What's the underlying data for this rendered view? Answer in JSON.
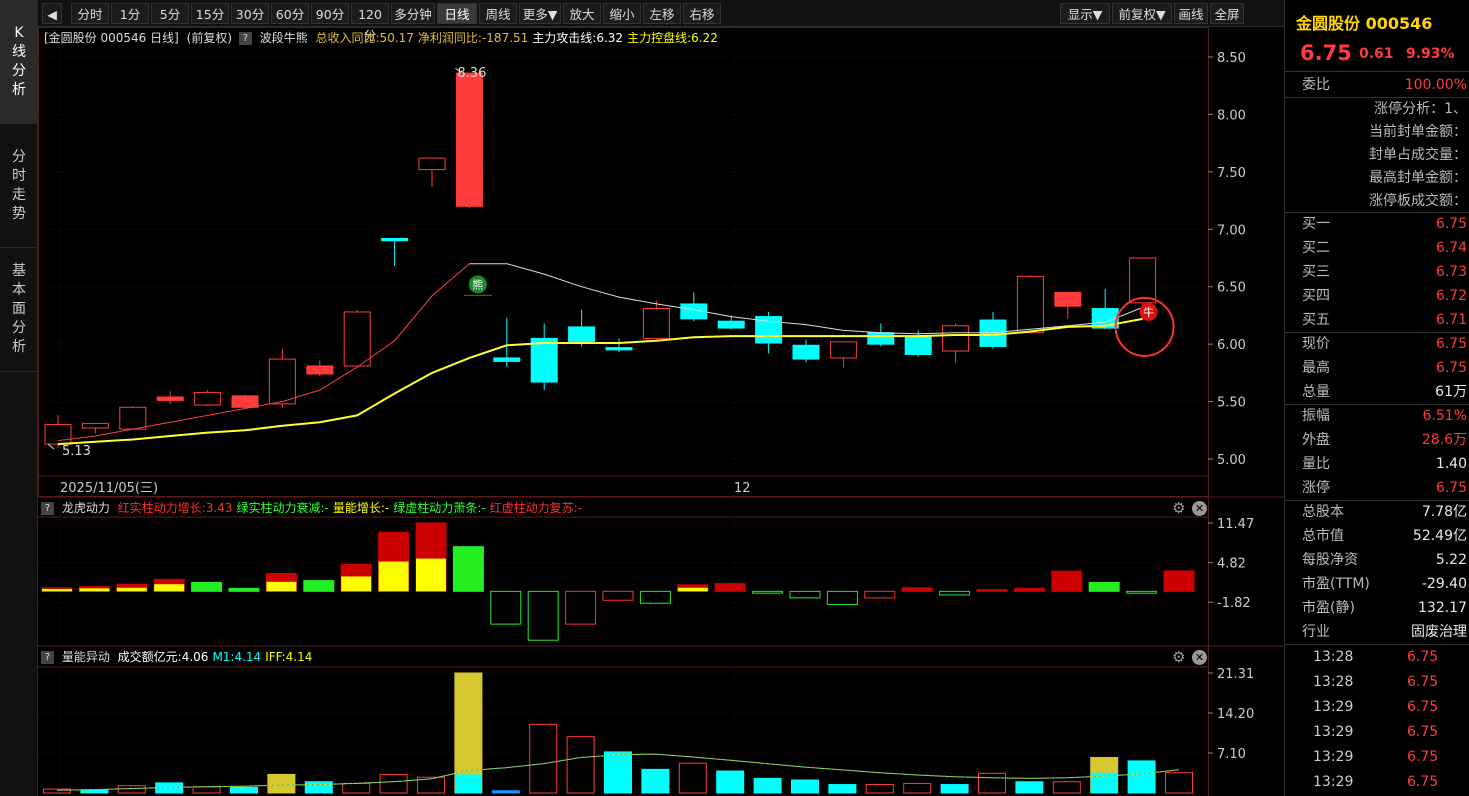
{
  "left_tabs": [
    {
      "label": "K线分析",
      "chars": [
        "K",
        "线",
        "分",
        "析"
      ]
    },
    {
      "label": "分时走势",
      "chars": [
        "分",
        "时",
        "走",
        "势"
      ]
    },
    {
      "label": "基本面分析",
      "chars": [
        "基",
        "本",
        "面",
        "分",
        "析"
      ]
    }
  ],
  "toolbar": {
    "toggle_icon": "◀",
    "periods": [
      "分时",
      "1分",
      "5分",
      "15分",
      "30分",
      "60分",
      "90分",
      "120分",
      "多分钟",
      "日线",
      "周线",
      "更多▼",
      "放大",
      "缩小",
      "左移",
      "右移"
    ],
    "active_period": "日线",
    "right_buttons": [
      "显示▼",
      "前复权▼",
      "画线",
      "全屏"
    ]
  },
  "main_panel": {
    "title_prefix": "[金圆股份 000546 日线]",
    "fq": "(前复权)",
    "indicator_name": "波段牛熊",
    "items": [
      {
        "text": "总收入同比:50.17",
        "color": "#e0c030"
      },
      {
        "text": "净利润同比:-187.51",
        "color": "#e0c030"
      },
      {
        "text": "主力攻击线:6.32",
        "color": "#ffffff"
      },
      {
        "text": "主力控盘线:6.22",
        "color": "#ffff00"
      }
    ],
    "y_ticks": [
      "8.50",
      "8.00",
      "7.50",
      "7.00",
      "6.50",
      "6.00",
      "5.50",
      "5.00"
    ],
    "date_label": "2025/11/05(三)",
    "month_label": "12",
    "high_label": "8.36",
    "low_label": "5.13",
    "bear_mark": "熊",
    "bull_mark": "牛"
  },
  "sub1": {
    "name": "龙虎动力",
    "items": [
      {
        "text": "红实柱动力增长:3.43",
        "color": "#ff3030"
      },
      {
        "text": "绿实柱动力衰减:-",
        "color": "#30ff30"
      },
      {
        "text": "量能增长:-",
        "color": "#ffff00"
      },
      {
        "text": "绿虚柱动力萧条:-",
        "color": "#30ff30"
      },
      {
        "text": "红虚柱动力复苏:-",
        "color": "#ff3030"
      }
    ],
    "y_ticks": [
      "11.47",
      "4.82",
      "-1.82"
    ]
  },
  "sub2": {
    "name": "量能异动",
    "items": [
      {
        "text": "成交额亿元:4.06",
        "color": "#ffffff"
      },
      {
        "text": "M1:4.14",
        "color": "#00ffff"
      },
      {
        "text": "IFF:4.14",
        "color": "#ffff00"
      }
    ],
    "y_ticks": [
      "21.31",
      "14.20",
      "7.10"
    ]
  },
  "quote": {
    "name": "金圆股份 000546",
    "price": "6.75",
    "change": "0.61",
    "pct": "9.93%",
    "weibi_label": "委比",
    "weibi": "100.00%",
    "limit_lines": [
      "涨停分析：1、",
      "当前封单金额：",
      "封单占成交量：",
      "最高封单金额：",
      "涨停板成交额："
    ],
    "bids": [
      {
        "label": "买一",
        "value": "6.75"
      },
      {
        "label": "买二",
        "value": "6.74"
      },
      {
        "label": "买三",
        "value": "6.73"
      },
      {
        "label": "买四",
        "value": "6.72"
      },
      {
        "label": "买五",
        "value": "6.71"
      }
    ],
    "stats1": [
      {
        "label": "现价",
        "value": "6.75",
        "color": "red"
      },
      {
        "label": "最高",
        "value": "6.75",
        "color": "red"
      },
      {
        "label": "总量",
        "value": "61万",
        "color": "white"
      }
    ],
    "stats2": [
      {
        "label": "振幅",
        "value": "6.51%",
        "color": "red"
      },
      {
        "label": "外盘",
        "value": "28.6万",
        "color": "red"
      },
      {
        "label": "量比",
        "value": "1.40",
        "color": "white"
      },
      {
        "label": "涨停",
        "value": "6.75",
        "color": "red"
      }
    ],
    "stats3": [
      {
        "label": "总股本",
        "value": "7.78亿",
        "color": "white"
      },
      {
        "label": "总市值",
        "value": "52.49亿",
        "color": "white"
      },
      {
        "label": "每股净资",
        "value": "5.22",
        "color": "white"
      },
      {
        "label": "市盈(TTM)",
        "value": "-29.40",
        "color": "white"
      },
      {
        "label": "市盈(静)",
        "value": "132.17",
        "color": "white"
      }
    ],
    "industry_label": "行业",
    "industry": "固废治理",
    "ticks": [
      {
        "time": "13:28",
        "price": "6.75"
      },
      {
        "time": "13:28",
        "price": "6.75"
      },
      {
        "time": "13:29",
        "price": "6.75"
      },
      {
        "time": "13:29",
        "price": "6.75"
      },
      {
        "time": "13:29",
        "price": "6.75"
      },
      {
        "time": "13:29",
        "price": "6.75"
      }
    ]
  },
  "colors": {
    "up": "#ff3b3b",
    "down": "#00ffff",
    "ma_fast": "#ff4040",
    "ma_slow": "#ffff33",
    "grid": "#3a1010"
  },
  "chart_data": {
    "type": "candlestick",
    "candles": [
      {
        "o": 5.13,
        "h": 5.38,
        "l": 5.1,
        "c": 5.3
      },
      {
        "o": 5.27,
        "h": 5.31,
        "l": 5.22,
        "c": 5.31
      },
      {
        "o": 5.26,
        "h": 5.46,
        "l": 5.25,
        "c": 5.45
      },
      {
        "o": 5.51,
        "h": 5.59,
        "l": 5.48,
        "c": 5.54
      },
      {
        "o": 5.47,
        "h": 5.6,
        "l": 5.46,
        "c": 5.58
      },
      {
        "o": 5.45,
        "h": 5.56,
        "l": 5.44,
        "c": 5.55
      },
      {
        "o": 5.48,
        "h": 5.96,
        "l": 5.45,
        "c": 5.87
      },
      {
        "o": 5.74,
        "h": 5.86,
        "l": 5.72,
        "c": 5.81
      },
      {
        "o": 5.81,
        "h": 6.3,
        "l": 5.8,
        "c": 6.28
      },
      {
        "o": 6.92,
        "h": 6.92,
        "l": 6.68,
        "c": 6.9
      },
      {
        "o": 7.52,
        "h": 7.62,
        "l": 7.37,
        "c": 7.62
      },
      {
        "o": 7.2,
        "h": 8.36,
        "l": 7.18,
        "c": 8.36
      },
      {
        "o": 5.88,
        "h": 6.23,
        "l": 5.8,
        "c": 5.85
      },
      {
        "o": 6.05,
        "h": 6.18,
        "l": 5.6,
        "c": 5.67
      },
      {
        "o": 6.15,
        "h": 6.3,
        "l": 5.98,
        "c": 6.02
      },
      {
        "o": 5.97,
        "h": 6.05,
        "l": 5.93,
        "c": 5.95
      },
      {
        "o": 6.05,
        "h": 6.38,
        "l": 6.04,
        "c": 6.31
      },
      {
        "o": 6.35,
        "h": 6.45,
        "l": 6.2,
        "c": 6.22
      },
      {
        "o": 6.2,
        "h": 6.25,
        "l": 6.13,
        "c": 6.14
      },
      {
        "o": 6.24,
        "h": 6.28,
        "l": 5.92,
        "c": 6.01
      },
      {
        "o": 5.99,
        "h": 6.04,
        "l": 5.84,
        "c": 5.87
      },
      {
        "o": 5.88,
        "h": 6.02,
        "l": 5.8,
        "c": 6.02
      },
      {
        "o": 6.1,
        "h": 6.18,
        "l": 5.98,
        "c": 6.0
      },
      {
        "o": 6.07,
        "h": 6.12,
        "l": 5.89,
        "c": 5.91
      },
      {
        "o": 5.94,
        "h": 6.18,
        "l": 5.84,
        "c": 6.16
      },
      {
        "o": 6.21,
        "h": 6.28,
        "l": 5.96,
        "c": 5.98
      },
      {
        "o": 6.1,
        "h": 6.6,
        "l": 6.1,
        "c": 6.59
      },
      {
        "o": 6.33,
        "h": 6.45,
        "l": 6.22,
        "c": 6.45
      },
      {
        "o": 6.31,
        "h": 6.48,
        "l": 6.13,
        "c": 6.14
      },
      {
        "o": 6.36,
        "h": 6.75,
        "l": 6.3,
        "c": 6.75
      }
    ],
    "ma_fast": [
      5.16,
      5.2,
      5.26,
      5.32,
      5.38,
      5.44,
      5.5,
      5.6,
      5.8,
      6.03,
      6.42,
      6.7,
      6.7,
      6.61,
      6.5,
      6.41,
      6.35,
      6.3,
      6.24,
      6.2,
      6.17,
      6.12,
      6.1,
      6.09,
      6.1,
      6.1,
      6.13,
      6.16,
      6.19,
      6.32
    ],
    "ma_slow": [
      5.13,
      5.15,
      5.17,
      5.2,
      5.23,
      5.25,
      5.29,
      5.32,
      5.38,
      5.57,
      5.75,
      5.88,
      5.99,
      6.01,
      6.01,
      6.01,
      6.03,
      6.06,
      6.07,
      6.07,
      6.07,
      6.07,
      6.07,
      6.07,
      6.08,
      6.08,
      6.11,
      6.15,
      6.16,
      6.22
    ],
    "ylim_main": [
      5.0,
      8.5
    ],
    "sub1_bars": [
      {
        "v": 0.6,
        "c": "red",
        "y": 0.4
      },
      {
        "v": 0.8,
        "c": "red",
        "y": 0.5
      },
      {
        "v": 1.2,
        "c": "red",
        "y": 0.6
      },
      {
        "v": 2.0,
        "c": "red",
        "y": 1.2
      },
      {
        "v": 1.5,
        "c": "green"
      },
      {
        "v": 0.5,
        "c": "green"
      },
      {
        "v": 3.0,
        "c": "red",
        "y": 1.6
      },
      {
        "v": 1.8,
        "c": "green"
      },
      {
        "v": 4.5,
        "c": "red",
        "y": 2.5
      },
      {
        "v": 9.9,
        "c": "red",
        "y": 5.0
      },
      {
        "v": 11.47,
        "c": "red",
        "y": 5.5
      },
      {
        "v": 7.5,
        "c": "green"
      },
      {
        "v": -5.5,
        "c": "green_hollow"
      },
      {
        "v": -8.2,
        "c": "green_hollow"
      },
      {
        "v": -5.5,
        "c": "red_hollow"
      },
      {
        "v": -1.5,
        "c": "red_hollow"
      },
      {
        "v": -2.0,
        "c": "green_hollow"
      },
      {
        "v": 1.1,
        "c": "red",
        "y": 0.6
      },
      {
        "v": 1.3,
        "c": "red"
      },
      {
        "v": -0.3,
        "c": "green_hollow"
      },
      {
        "v": -1.1,
        "c": "green_hollow"
      },
      {
        "v": -2.2,
        "c": "green_hollow"
      },
      {
        "v": -1.1,
        "c": "red_hollow"
      },
      {
        "v": 0.6,
        "c": "red"
      },
      {
        "v": -0.6,
        "c": "green_hollow"
      },
      {
        "v": 0.3,
        "c": "red"
      },
      {
        "v": 0.5,
        "c": "red"
      },
      {
        "v": 3.4,
        "c": "red"
      },
      {
        "v": 1.5,
        "c": "green"
      },
      {
        "v": -0.3,
        "c": "green_hollow"
      },
      {
        "v": 3.43,
        "c": "red"
      }
    ],
    "ylim_sub1": [
      -8.5,
      11.47
    ],
    "sub2_bars": [
      {
        "v": 0.7,
        "c": "red"
      },
      {
        "v": 0.5,
        "c": "cyan"
      },
      {
        "v": 1.3,
        "c": "red"
      },
      {
        "v": 1.8,
        "c": "cyan"
      },
      {
        "v": 1.1,
        "c": "red"
      },
      {
        "v": 1.0,
        "c": "cyan"
      },
      {
        "v": 3.3,
        "c": "yellow"
      },
      {
        "v": 2.0,
        "c": "cyan"
      },
      {
        "v": 1.7,
        "c": "red"
      },
      {
        "v": 3.3,
        "c": "red"
      },
      {
        "v": 2.8,
        "c": "red"
      },
      {
        "v": 21.31,
        "c": "yellow",
        "cyan_part": 3.3
      },
      {
        "v": 0.4,
        "c": "blue"
      },
      {
        "v": 12.2,
        "c": "red"
      },
      {
        "v": 10.0,
        "c": "red"
      },
      {
        "v": 7.3,
        "c": "cyan"
      },
      {
        "v": 4.2,
        "c": "cyan"
      },
      {
        "v": 5.3,
        "c": "red"
      },
      {
        "v": 3.9,
        "c": "cyan"
      },
      {
        "v": 2.6,
        "c": "cyan"
      },
      {
        "v": 2.3,
        "c": "cyan"
      },
      {
        "v": 1.5,
        "c": "cyan"
      },
      {
        "v": 1.5,
        "c": "red"
      },
      {
        "v": 1.7,
        "c": "red"
      },
      {
        "v": 1.5,
        "c": "cyan"
      },
      {
        "v": 3.5,
        "c": "red"
      },
      {
        "v": 2.0,
        "c": "cyan"
      },
      {
        "v": 2.0,
        "c": "red"
      },
      {
        "v": 6.3,
        "c": "yellow",
        "cyan_part": 3.6
      },
      {
        "v": 5.7,
        "c": "cyan"
      },
      {
        "v": 3.6,
        "c": "red"
      }
    ],
    "sub2_ma": [
      0.5,
      0.6,
      0.8,
      1.0,
      1.1,
      1.2,
      1.4,
      1.5,
      1.7,
      2.0,
      2.5,
      4.0,
      4.5,
      5.2,
      6.3,
      6.8,
      6.9,
      6.4,
      5.8,
      5.2,
      4.6,
      4.1,
      3.6,
      3.2,
      2.9,
      2.7,
      2.6,
      2.7,
      3.0,
      3.4,
      4.14
    ],
    "ylim_sub2": [
      0,
      21.31
    ]
  }
}
